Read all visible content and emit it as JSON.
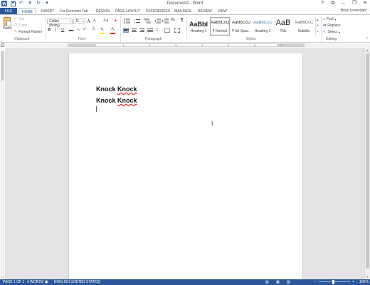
{
  "app": {
    "title": "Document1 - Word",
    "user": "Brian Underdahl"
  },
  "window_controls": [
    "?",
    "⧉",
    "–",
    "❐",
    "✕"
  ],
  "tabs": [
    {
      "label": "FILE"
    },
    {
      "label": "HOME"
    },
    {
      "label": "INSERT"
    },
    {
      "label": "For Dummies Tab"
    },
    {
      "label": "DESIGN"
    },
    {
      "label": "PAGE LAYOUT"
    },
    {
      "label": "REFERENCES"
    },
    {
      "label": "MAILINGS"
    },
    {
      "label": "REVIEW"
    },
    {
      "label": "VIEW"
    }
  ],
  "clipboard": {
    "paste": "Paste",
    "cut": "Cut",
    "copy": "Copy",
    "format_painter": "Format Painter",
    "group": "Clipboard"
  },
  "font": {
    "name": "Calibri (Body)",
    "size": "11",
    "grow": "A",
    "shrink": "A",
    "case": "Aa",
    "bold": "B",
    "italic": "I",
    "underline": "U",
    "strike": "abc",
    "subscript": "x₂",
    "superscript": "x²",
    "group": "Font"
  },
  "paragraph": {
    "group": "Paragraph",
    "show_marks": "¶"
  },
  "styles": {
    "group": "Styles",
    "items": [
      {
        "sample": "AaBbI",
        "name": "Heading 1"
      },
      {
        "sample": "AaBbCcDc",
        "name": "¶ Normal"
      },
      {
        "sample": "AaBbCcDc",
        "name": "¶ No Spac..."
      },
      {
        "sample": "AaBbCcC",
        "name": "Heading 2"
      },
      {
        "sample": "AaB",
        "name": "Title"
      },
      {
        "sample": "AaBbCcC",
        "name": "Subtitle"
      }
    ]
  },
  "editing": {
    "group": "Editing",
    "find": "Find",
    "replace": "Replace",
    "select": "Select"
  },
  "ruler_numbers": [
    "1",
    "2",
    "3",
    "4",
    "5",
    "6",
    "7"
  ],
  "document": {
    "lines": [
      {
        "w1": "Knock",
        "w2": "Knock"
      },
      {
        "w1": "Knock",
        "w2": "Knock"
      }
    ]
  },
  "status": {
    "page": "PAGE 1 OF 1",
    "words": "4 WORDS",
    "language": "ENGLISH (UNITED STATES)",
    "zoom_minus": "−",
    "zoom_plus": "+",
    "zoom": "100%"
  },
  "colors": {
    "accent": "#2b579a",
    "spell_error": "#e00000"
  },
  "icons": {
    "save": "save-icon",
    "undo": "undo-icon",
    "redo": "redo-icon",
    "customize": "customize-qat-icon",
    "cut": "scissors-icon",
    "copy": "copy-icon",
    "format_painter": "brush-icon",
    "find": "binoculars-icon",
    "replace": "replace-icon",
    "select": "cursor-icon"
  }
}
